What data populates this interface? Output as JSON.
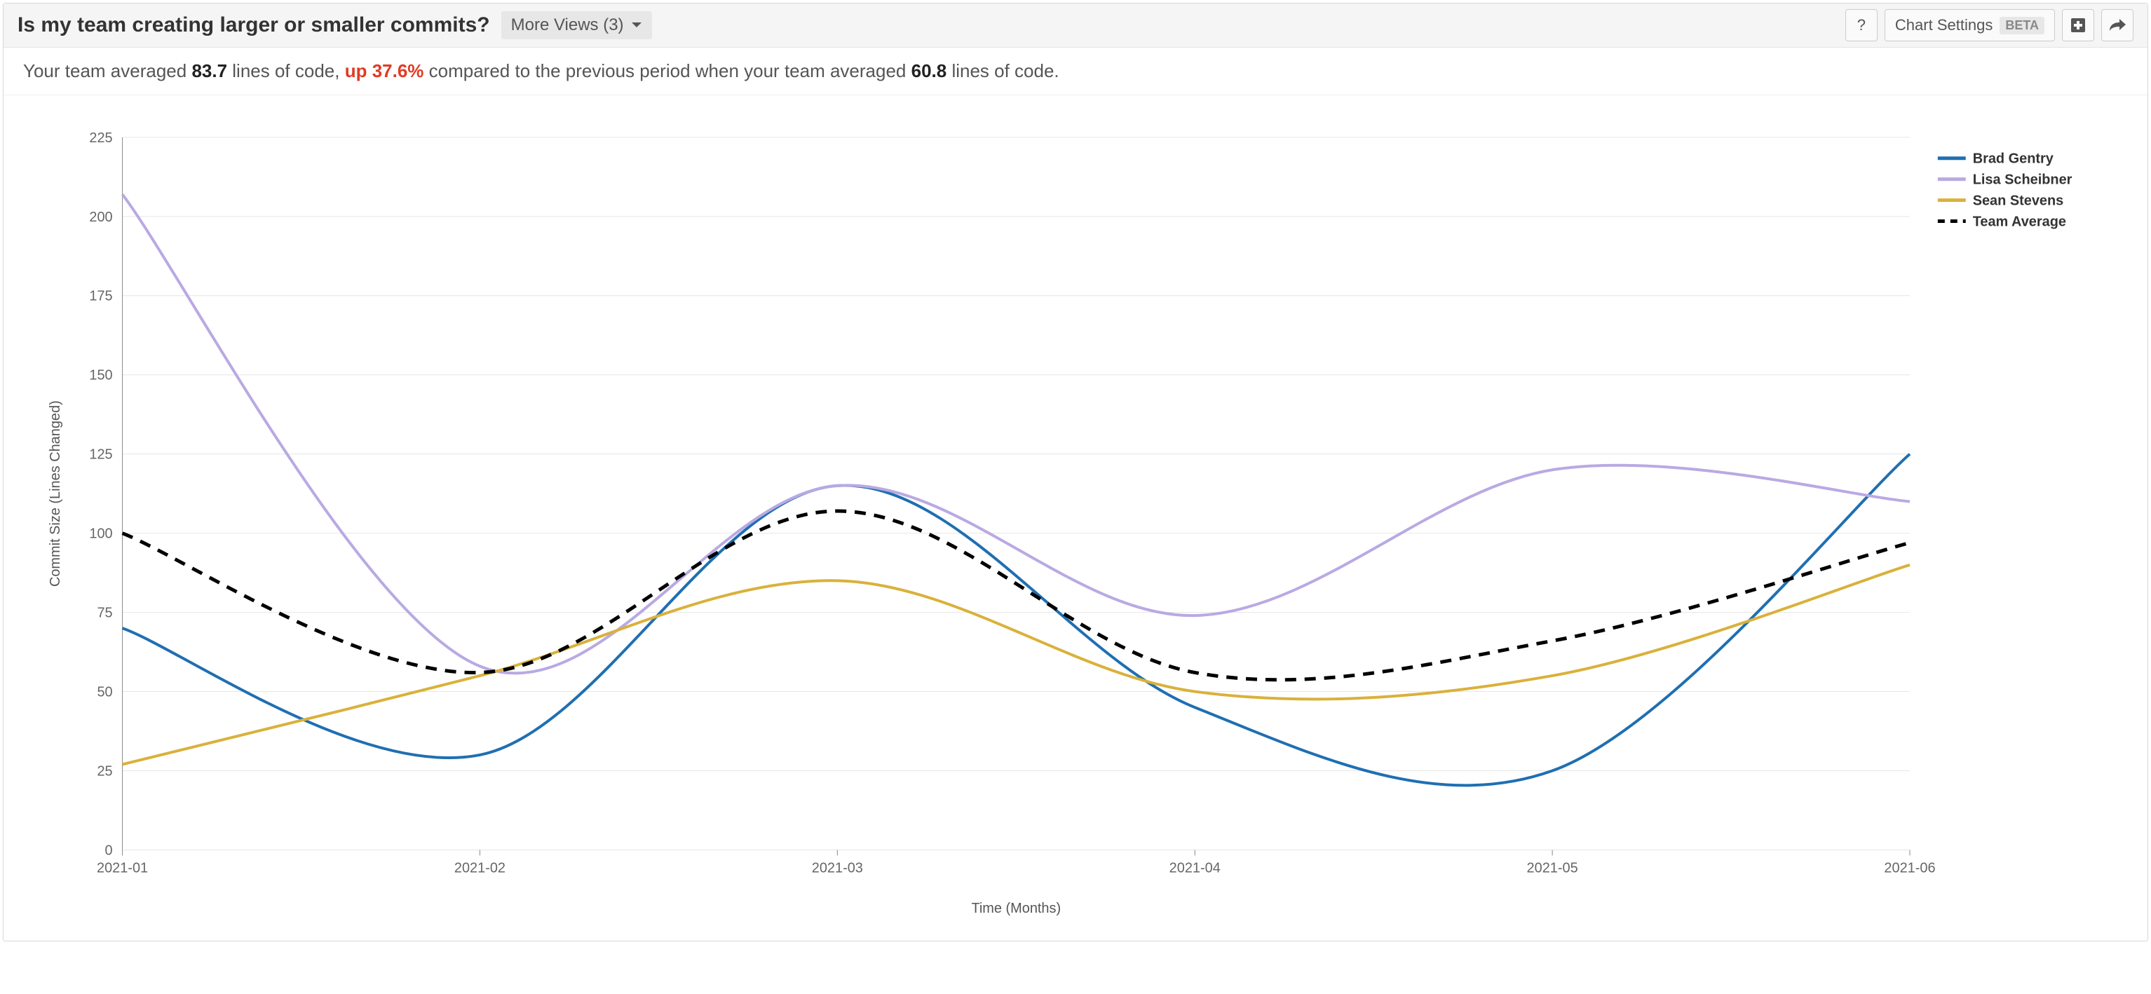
{
  "header": {
    "title": "Is my team creating larger or smaller commits?",
    "more_views_label": "More Views (3)",
    "help_label": "?",
    "chart_settings_label": "Chart Settings",
    "beta_label": "BETA"
  },
  "summary": {
    "pre": "Your team averaged ",
    "avg_current": "83.7",
    "mid1": " lines of code, ",
    "delta": "up 37.6%",
    "mid2": " compared to the previous period when your team averaged ",
    "avg_prev": "60.8",
    "post": " lines of code."
  },
  "chart_data": {
    "type": "line",
    "title": "",
    "xlabel": "Time (Months)",
    "ylabel": "Commit Size (Lines Changed)",
    "categories": [
      "2021-01",
      "2021-02",
      "2021-03",
      "2021-04",
      "2021-05",
      "2021-06"
    ],
    "ylim": [
      0,
      225
    ],
    "yticks": [
      0,
      25,
      50,
      75,
      100,
      125,
      150,
      175,
      200,
      225
    ],
    "series": [
      {
        "name": "Brad Gentry",
        "color": "#1f6fb2",
        "dash": false,
        "values": [
          70,
          30,
          115,
          45,
          25,
          125
        ]
      },
      {
        "name": "Lisa Scheibner",
        "color": "#b9a9e3",
        "dash": false,
        "values": [
          207,
          58,
          115,
          74,
          120,
          110
        ]
      },
      {
        "name": "Sean Stevens",
        "color": "#d9b13b",
        "dash": false,
        "values": [
          27,
          55,
          85,
          50,
          55,
          90
        ]
      },
      {
        "name": "Team Average",
        "color": "#000000",
        "dash": true,
        "values": [
          100,
          56,
          107,
          56,
          66,
          97
        ]
      }
    ],
    "legend_position": "right"
  }
}
